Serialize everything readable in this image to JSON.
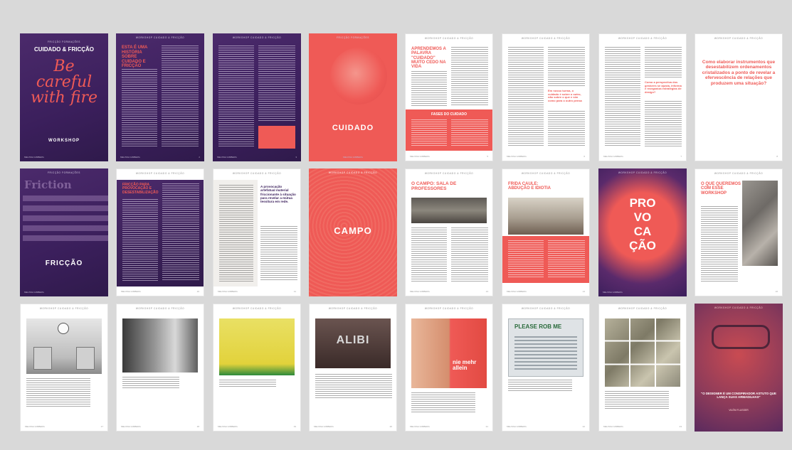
{
  "header_cf": "WORKSHOP CUIDADO & FRICÇÃO",
  "header_cover": "FRICÇÃO FORMAÇÕES",
  "cover": {
    "title": "CUIDADO & FRICÇÃO",
    "script": "Be careful with fire",
    "subtitle": "WORKSHOP"
  },
  "p2": {
    "title": "ESTA É UMA HISTÓRIA SOBRE CUIDADO E FRICÇÃO"
  },
  "p4": {
    "label": "CUIDADO"
  },
  "p5": {
    "title": "APRENDEMOS A PALAVRA \"CUIDADO\" MUITO CEDO NA VIDA",
    "box_title": "FASES DO CUIDADO"
  },
  "p6": {
    "highlight": "Em nosso turma, o cuidado é sobre o outro, não sobre o que e sim como para o outro pensa"
  },
  "p7": {
    "highlight": "Como a perspectiva dos gestores se ajusta, informa e reorganiza estratégias de design?"
  },
  "p8": {
    "quote": "Como elaborar instrumentos que desestabilizem ordenamentos cristalizados a ponto de revelar a efervescência de relações que produzem uma situação?"
  },
  "p9": {
    "word": "Friction",
    "label": "FRICÇÃO"
  },
  "p10": {
    "title": "FRICÇÃO PARA PROVOCAÇÃO E DESESTABILIZAÇÃO"
  },
  "p11": {
    "quote": "A provocação artefatual material friccionante à situação para revelar a mútua tessitura em rede."
  },
  "p12": {
    "label": "CAMPO"
  },
  "p13": {
    "title": "O CAMPO: SALA DE PROFESSORES"
  },
  "p14": {
    "title": "FRIDA CAULE: ABDUÇÃO E IDIOTIA"
  },
  "p15": {
    "lines": [
      "PRO",
      "VO",
      "CA",
      "ÇÃO"
    ]
  },
  "p16": {
    "title": "O QUE QUEREMOS COM ESSE WORKSHOP"
  },
  "p20": {
    "sign": "ALIBI"
  },
  "p21": {
    "words": "nie mehr allein"
  },
  "p22": {
    "sign": "PLEASE ROB ME"
  },
  "p24": {
    "quote": "\"O DESIGNER É UM CONSPIRADOR ASTUTO QUE LANÇA SUAS ARMADILHAS\"",
    "author": "VILÉM FLUSSER"
  },
  "footer_left": "MELISSA GIMBERG",
  "page_labels": [
    "1",
    "2",
    "3",
    "4",
    "5",
    "6",
    "7",
    "8",
    "9",
    "10",
    "11",
    "12",
    "13",
    "14",
    "15",
    "16",
    "17",
    "18",
    "19",
    "20",
    "21",
    "22",
    "23",
    "24"
  ]
}
